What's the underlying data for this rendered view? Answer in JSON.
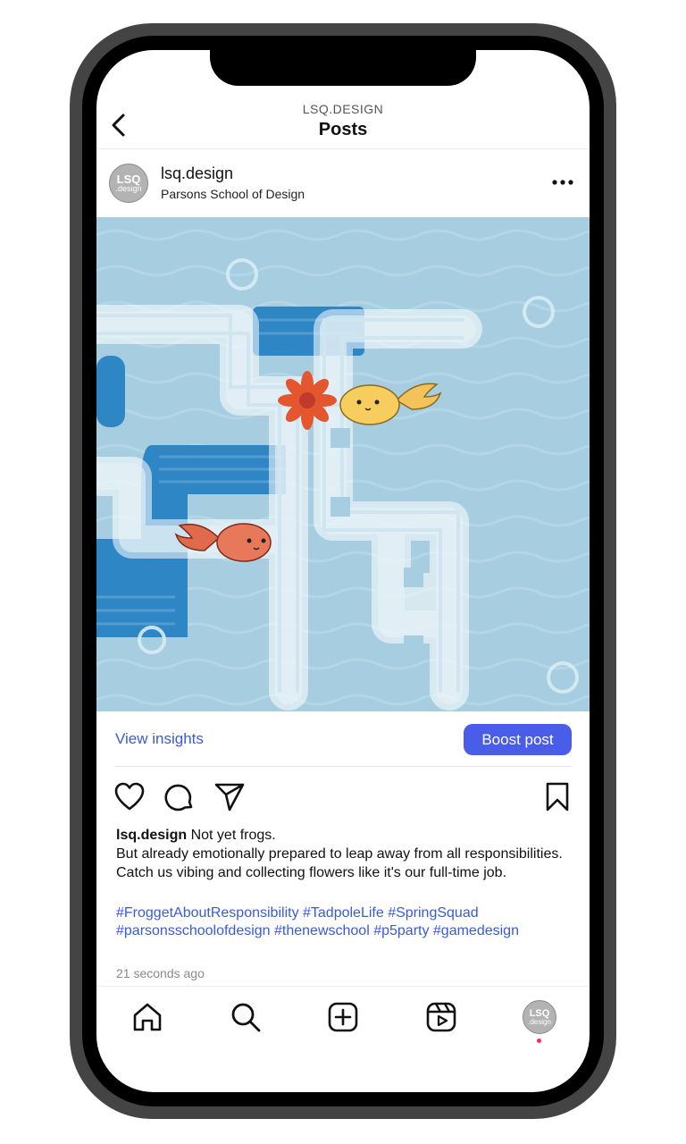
{
  "header": {
    "subtitle": "LSQ.DESIGN",
    "title": "Posts"
  },
  "account": {
    "avatar_line1": "LSQ",
    "avatar_line2": ".design",
    "username": "lsq.design",
    "location": "Parsons School of Design"
  },
  "insights": {
    "view_label": "View insights",
    "boost_label": "Boost post"
  },
  "caption": {
    "username": "lsq.design",
    "line1": "Not yet frogs.",
    "line2": "But already emotionally prepared to leap away from all responsibilities.",
    "line3": "Catch us vibing and collecting flowers like it's our full-time job.",
    "hashtags": "#FroggetAboutResponsibility #TadpoleLife #SpringSquad #parsonsschoolofdesign #thenewschool #p5party #gamedesign",
    "timestamp": "21 seconds ago"
  },
  "colors": {
    "accent": "#3a5bd9",
    "boost_bg": "#4a5de8",
    "water": "#a7cfe0",
    "deep_channel": "#2f86c4"
  },
  "icons": [
    "back-arrow-icon",
    "more-dots-icon",
    "heart-icon",
    "comment-icon",
    "share-icon",
    "bookmark-icon",
    "home-icon",
    "search-icon",
    "create-icon",
    "reels-icon",
    "profile-avatar"
  ]
}
